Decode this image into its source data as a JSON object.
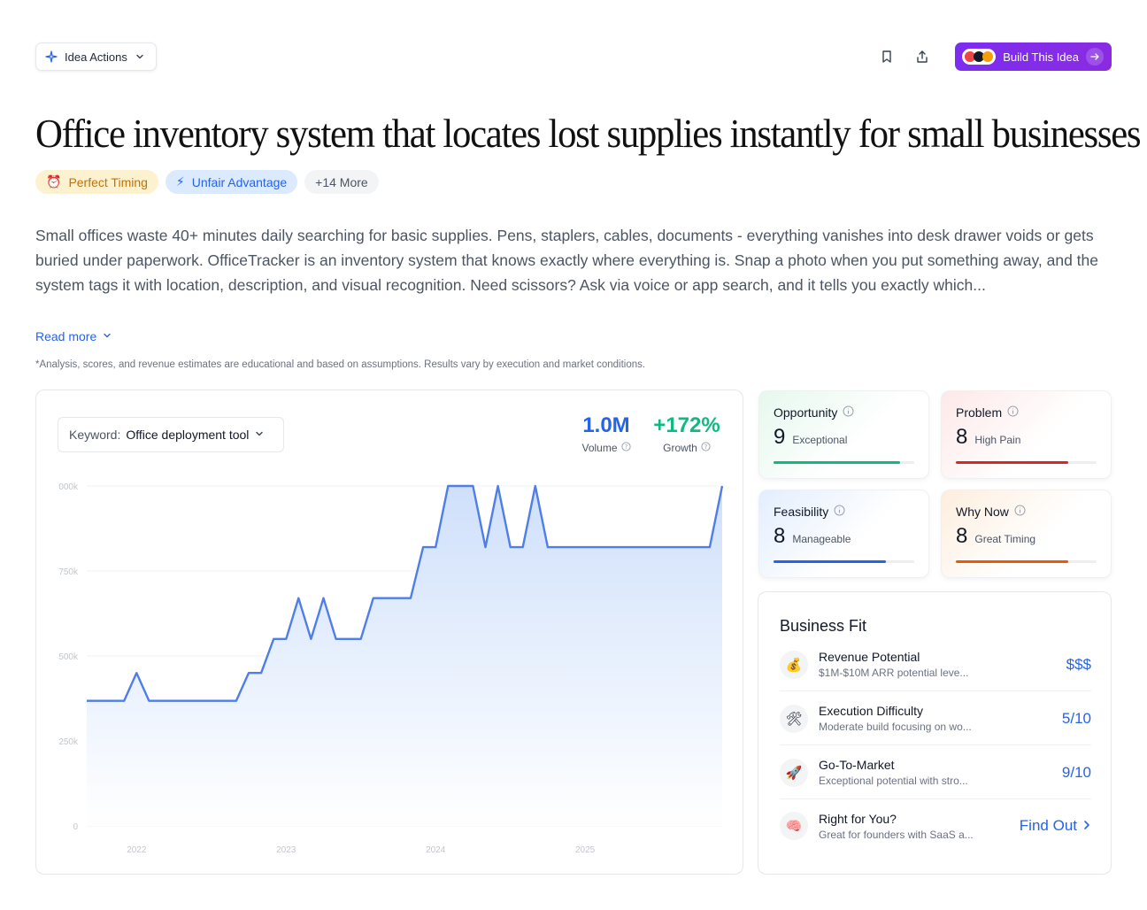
{
  "top_bar": {
    "idea_actions_label": "Idea Actions",
    "build_label": "Build This Idea"
  },
  "title": "Office inventory system that locates lost supplies instantly for small businesses",
  "tags": [
    {
      "icon": "alarm-clock",
      "label": "Perfect Timing"
    },
    {
      "icon": "lightning",
      "label": "Unfair Advantage"
    },
    {
      "label": "+14 More"
    }
  ],
  "description": "Small offices waste 40+ minutes daily searching for basic supplies. Pens, staplers, cables, documents - everything vanishes into desk drawer voids or gets buried under paperwork. OfficeTracker is an inventory system that knows exactly where everything is. Snap a photo when you put something away, and the system tags it with location, description, and visual recognition. Need scissors? Ask via voice or app search, and it tells you exactly which...",
  "read_more_label": "Read more",
  "disclaimer": "*Analysis, scores, and revenue estimates are educational and based on assumptions. Results vary by execution and market conditions.",
  "keyword": {
    "label": "Keyword:",
    "value": "Office deployment tool"
  },
  "metrics": {
    "volume": {
      "value": "1.0M",
      "label": "Volume"
    },
    "growth": {
      "value": "+172%",
      "label": "Growth"
    }
  },
  "chart_data": {
    "type": "area",
    "ylim": [
      0,
      1000000
    ],
    "y_ticks": [
      "0",
      "250k",
      "500k",
      "750k",
      "000k"
    ],
    "x_ticks": [
      "2022",
      "2023",
      "2024",
      "2025"
    ],
    "x_range": [
      "2021-09",
      "2025-12"
    ],
    "series": [
      {
        "x": [
          "2021-09",
          "2021-10",
          "2021-11",
          "2021-12",
          "2022-01",
          "2022-02",
          "2022-03",
          "2022-04",
          "2022-05",
          "2022-06",
          "2022-07",
          "2022-08",
          "2022-09",
          "2022-10",
          "2022-11",
          "2022-12",
          "2023-01",
          "2023-02",
          "2023-03",
          "2023-04",
          "2023-05",
          "2023-06",
          "2023-07",
          "2023-08",
          "2023-09",
          "2023-10",
          "2023-11",
          "2023-12",
          "2024-01",
          "2024-02",
          "2024-03",
          "2024-04",
          "2024-05",
          "2024-06",
          "2024-07",
          "2024-08",
          "2024-09",
          "2024-10",
          "2024-11",
          "2024-12",
          "2025-01",
          "2025-02",
          "2025-03",
          "2025-04",
          "2025-05",
          "2025-06",
          "2025-07",
          "2025-08",
          "2025-09",
          "2025-10",
          "2025-11",
          "2025-12"
        ],
        "values": [
          368000,
          368000,
          368000,
          368000,
          450000,
          368000,
          368000,
          368000,
          368000,
          368000,
          368000,
          368000,
          368000,
          450000,
          450000,
          550000,
          550000,
          670000,
          550000,
          670000,
          550000,
          550000,
          550000,
          670000,
          670000,
          670000,
          670000,
          820000,
          820000,
          1000000,
          1000000,
          1000000,
          820000,
          1000000,
          820000,
          820000,
          1000000,
          820000,
          820000,
          820000,
          820000,
          820000,
          820000,
          820000,
          820000,
          820000,
          820000,
          820000,
          820000,
          820000,
          820000,
          1000000
        ]
      }
    ],
    "colors": {
      "line": "#4f7ee8",
      "fill_top": "#cfe0fb",
      "fill_bottom": "#ffffff",
      "grid": "#eef0f3",
      "tick": "#c2c6cc"
    }
  },
  "scores": [
    {
      "title": "Opportunity",
      "value": "9",
      "tag": "Exceptional",
      "fraction": 0.9,
      "color": "#10b981"
    },
    {
      "title": "Problem",
      "value": "8",
      "tag": "High Pain",
      "fraction": 0.8,
      "color": "#dc2626"
    },
    {
      "title": "Feasibility",
      "value": "8",
      "tag": "Manageable",
      "fraction": 0.8,
      "color": "#2563eb"
    },
    {
      "title": "Why Now",
      "value": "8",
      "tag": "Great Timing",
      "fraction": 0.8,
      "color": "#ea580c"
    }
  ],
  "business_fit": {
    "title": "Business Fit",
    "rows": [
      {
        "icon": "money-bag",
        "glyph": "💰",
        "name": "Revenue Potential",
        "sub": "$1M-$10M ARR potential leve...",
        "value": "$$$"
      },
      {
        "icon": "tools",
        "glyph": "🛠",
        "name": "Execution Difficulty",
        "sub": "Moderate build focusing on wo...",
        "value": "5/10"
      },
      {
        "icon": "rocket",
        "glyph": "🚀",
        "name": "Go-To-Market",
        "sub": "Exceptional potential with stro...",
        "value": "9/10"
      },
      {
        "icon": "brain",
        "glyph": "🧠",
        "name": "Right for You?",
        "sub": "Great for founders with SaaS a...",
        "value": "Find Out"
      }
    ]
  }
}
